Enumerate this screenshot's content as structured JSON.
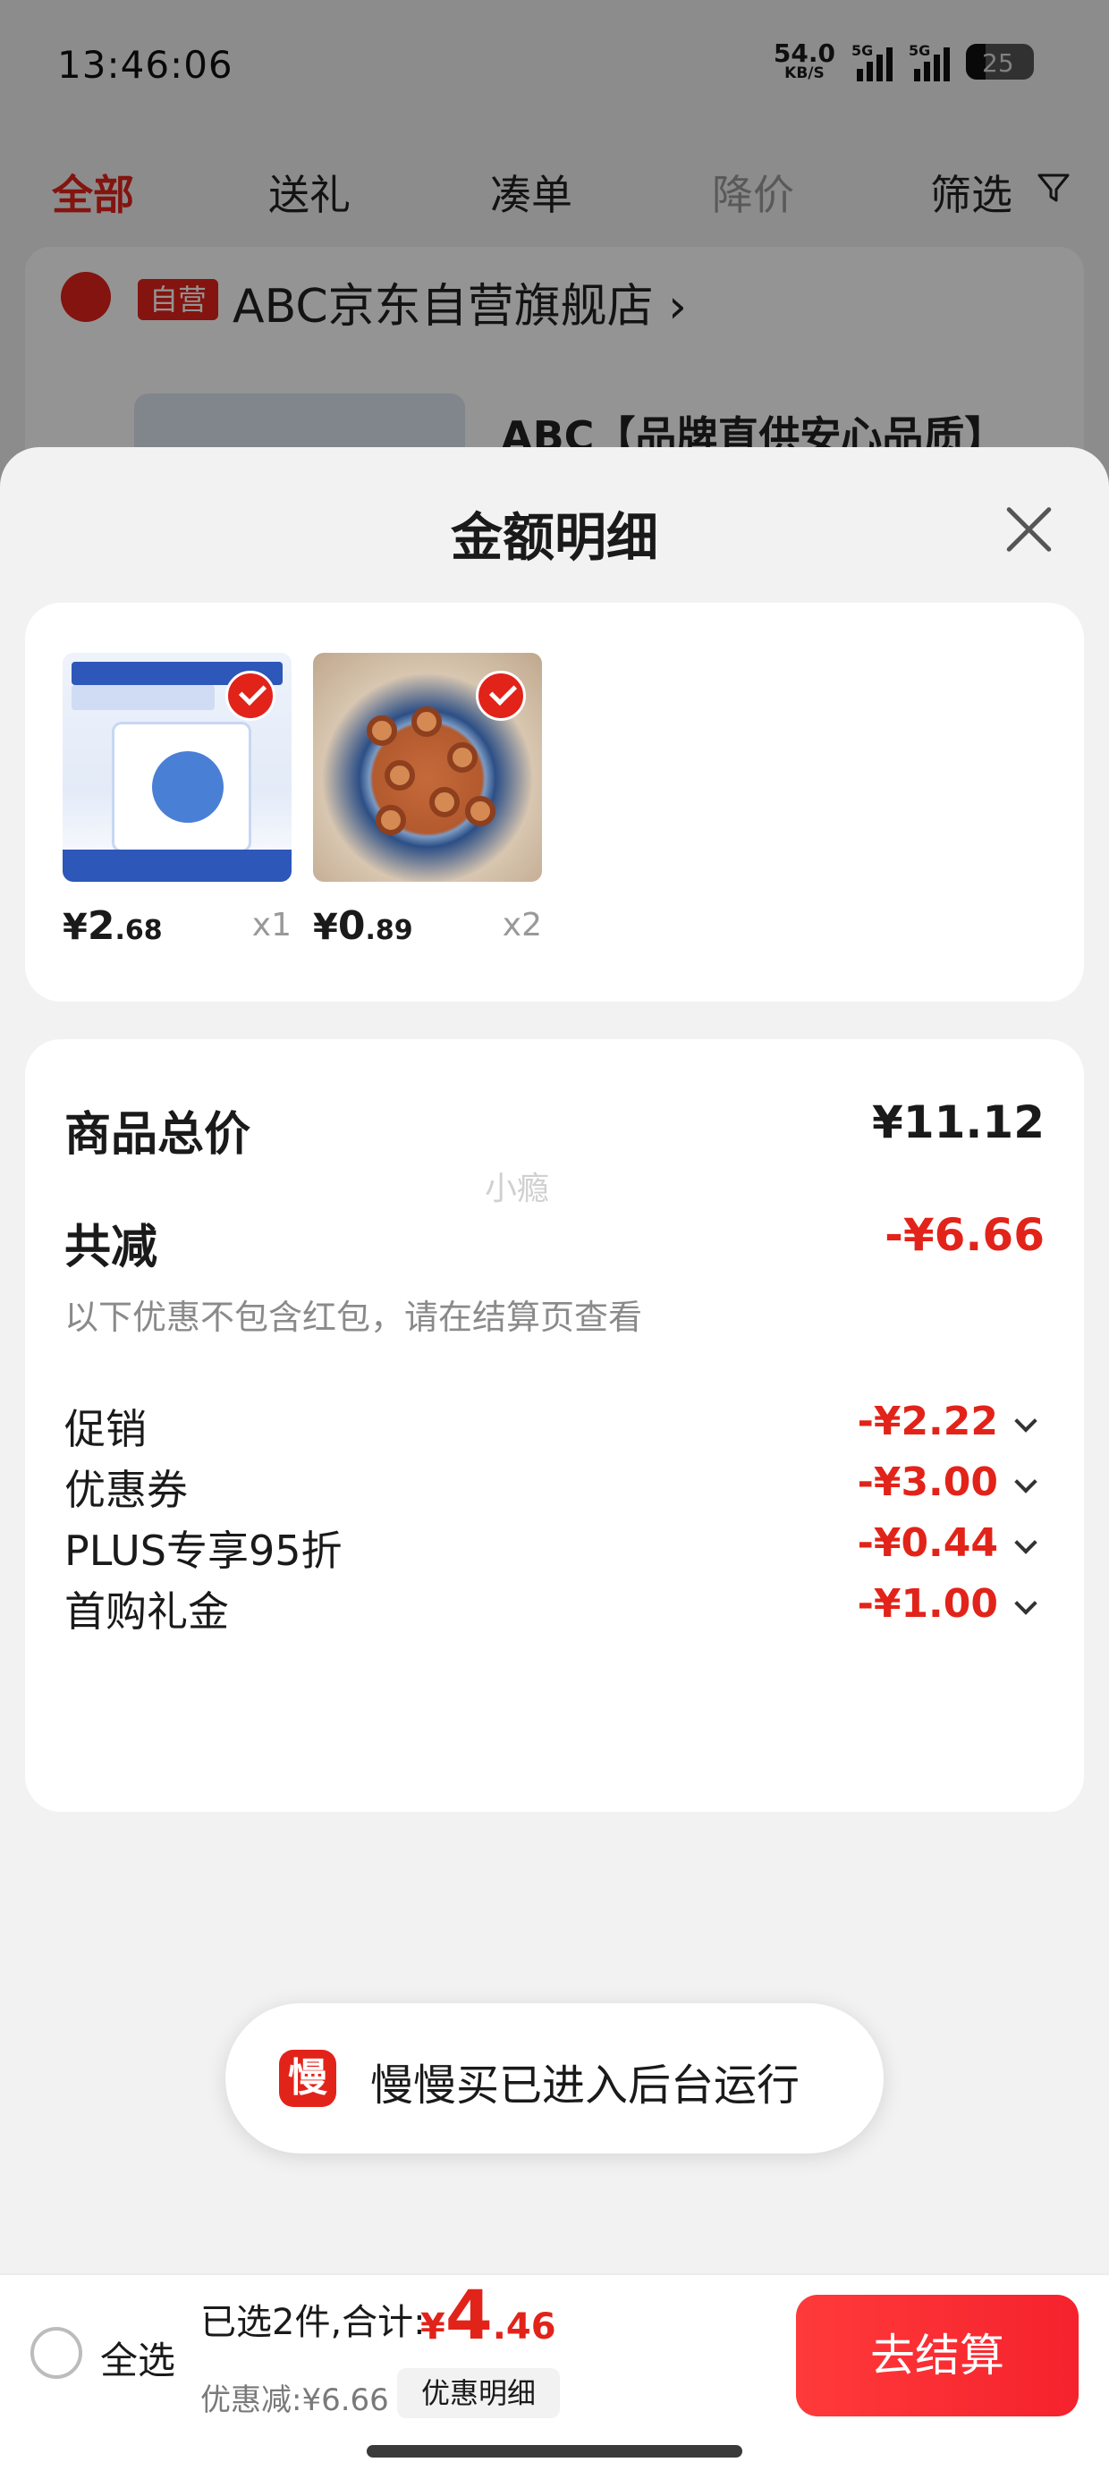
{
  "status": {
    "time": "13:46:06",
    "net_speed": "54.0",
    "net_unit": "KB/S",
    "sig1_tag": "5G",
    "sig2_tag": "5G",
    "battery": "25"
  },
  "background": {
    "tabs": [
      "全部",
      "送礼",
      "凑单",
      "降价",
      "筛选"
    ],
    "store_badge": "自营",
    "store_name": "ABC京东自营旗舰店 ›",
    "product_title": "ABC【品牌直供安心品质】"
  },
  "sheet": {
    "title": "金额明细",
    "products": [
      {
        "price_currency": "¥",
        "price_int": "2",
        "price_dec": ".68",
        "qty": "x1"
      },
      {
        "price_currency": "¥",
        "price_int": "0",
        "price_dec": ".89",
        "qty": "x2"
      }
    ],
    "total_label": "商品总价",
    "total_value": "¥11.12",
    "reduce_label": "共减",
    "reduce_value": "-¥6.66",
    "watermark": "小瘾",
    "note": "以下优惠不包含红包，请在结算页查看",
    "discounts": [
      {
        "label": "促销",
        "value": "-¥2.22"
      },
      {
        "label": "优惠券",
        "value": "-¥3.00"
      },
      {
        "label": "PLUS专享95折",
        "value": "-¥0.44"
      },
      {
        "label": "首购礼金",
        "value": "-¥1.00"
      }
    ]
  },
  "toast": {
    "icon_char": "慢",
    "text": "慢慢买已进入后台运行"
  },
  "bottom": {
    "select_all": "全选",
    "summary": "已选2件,合计:",
    "total_currency": "¥",
    "total_int": "4",
    "total_dec": ".46",
    "saved": "优惠减:¥6.66",
    "detail_button": "优惠明细",
    "checkout": "去结算"
  },
  "colors": {
    "accent": "#e2231a",
    "overlay": "rgba(0,0,0,0.42)"
  }
}
